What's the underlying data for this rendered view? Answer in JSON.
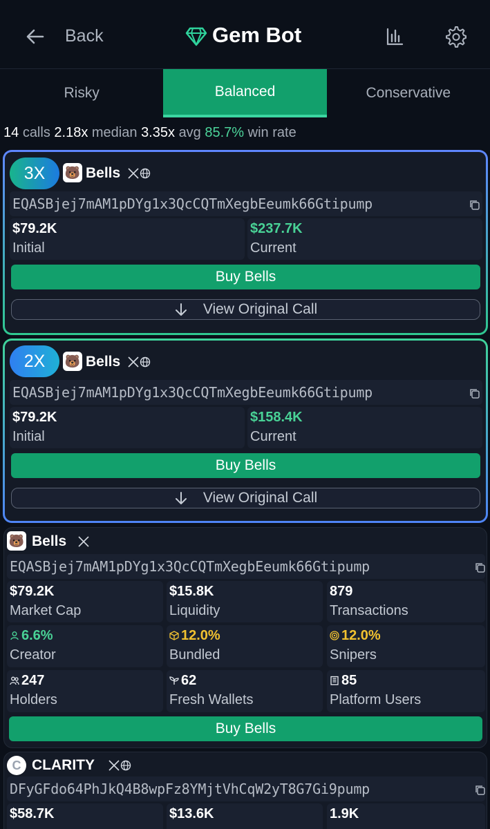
{
  "header": {
    "back_label": "Back",
    "title": "Gem Bot",
    "icons": [
      "back-arrow-icon",
      "gem-icon",
      "bar-chart-icon",
      "gear-icon"
    ]
  },
  "tabs": [
    {
      "label": "Risky",
      "active": false
    },
    {
      "label": "Balanced",
      "active": true
    },
    {
      "label": "Conservative",
      "active": false
    }
  ],
  "summary": {
    "calls_count": "14",
    "calls_label": "calls",
    "median_value": "2.18x",
    "median_label": "median",
    "avg_value": "3.35x",
    "avg_label": "avg",
    "win_rate_value": "85.7%",
    "win_rate_label": "win rate"
  },
  "colors": {
    "accent_green": "#12a06c",
    "positive_text": "#49d296",
    "warning_text": "#f2c230",
    "background": "#0b1019",
    "card": "#141a26"
  },
  "calls": [
    {
      "multiplier": "3X",
      "token_name": "Bells",
      "token_logo": "🐻",
      "address": "EQASBjej7mAM1pDYg1x3QcCQTmXegbEeumk66Gtipump",
      "initial_value": "$79.2K",
      "initial_label": "Initial",
      "current_value": "$237.7K",
      "current_label": "Current",
      "buy_label": "Buy Bells",
      "view_label": "View Original Call"
    },
    {
      "multiplier": "2X",
      "token_name": "Bells",
      "token_logo": "🐻",
      "address": "EQASBjej7mAM1pDYg1x3QcCQTmXegbEeumk66Gtipump",
      "initial_value": "$79.2K",
      "initial_label": "Initial",
      "current_value": "$158.4K",
      "current_label": "Current",
      "buy_label": "Buy Bells",
      "view_label": "View Original Call"
    }
  ],
  "tokens": [
    {
      "token_name": "Bells",
      "token_logo": "🐻",
      "address": "EQASBjej7mAM1pDYg1x3QcCQTmXegbEeumk66Gtipump",
      "stats": [
        {
          "value": "$79.2K",
          "label": "Market Cap"
        },
        {
          "value": "$15.8K",
          "label": "Liquidity"
        },
        {
          "value": "879",
          "label": "Transactions"
        },
        {
          "value": "6.6%",
          "label": "Creator",
          "icon": "person-icon"
        },
        {
          "value": "12.0%",
          "label": "Bundled",
          "icon": "box-icon"
        },
        {
          "value": "12.0%",
          "label": "Snipers",
          "icon": "target-icon"
        },
        {
          "value": "247",
          "label": "Holders",
          "icon": "people-icon"
        },
        {
          "value": "62",
          "label": "Fresh Wallets",
          "icon": "sprout-icon"
        },
        {
          "value": "85",
          "label": "Platform Users",
          "icon": "building-icon"
        }
      ],
      "buy_label": "Buy Bells"
    },
    {
      "token_name": "CLARITY",
      "token_logo": "C",
      "address": "DFyGFdo64PhJkQ4B8wpFz8YMjtVhCqW2yT8G7Gi9pump",
      "stats": [
        {
          "value": "$58.7K",
          "label": ""
        },
        {
          "value": "$13.6K",
          "label": ""
        },
        {
          "value": "1.9K",
          "label": ""
        }
      ]
    }
  ]
}
